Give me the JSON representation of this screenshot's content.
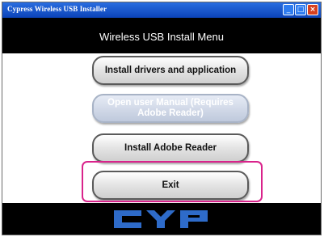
{
  "window": {
    "title": "Cypress Wireless USB Installer",
    "minimize_glyph": "_",
    "maximize_glyph": "□",
    "close_glyph": "×"
  },
  "header": {
    "title": "Wireless USB Install Menu"
  },
  "menu": {
    "install_drivers": "Install drivers and application",
    "open_manual": "Open user Manual (Requires Adobe Reader)",
    "install_reader": "Install Adobe Reader",
    "exit": "Exit"
  },
  "footer": {
    "logo_text": "CYP",
    "logo_color": "#2e6bc9"
  },
  "colors": {
    "titlebar": "#0b43b8",
    "highlight": "#d9238b"
  }
}
